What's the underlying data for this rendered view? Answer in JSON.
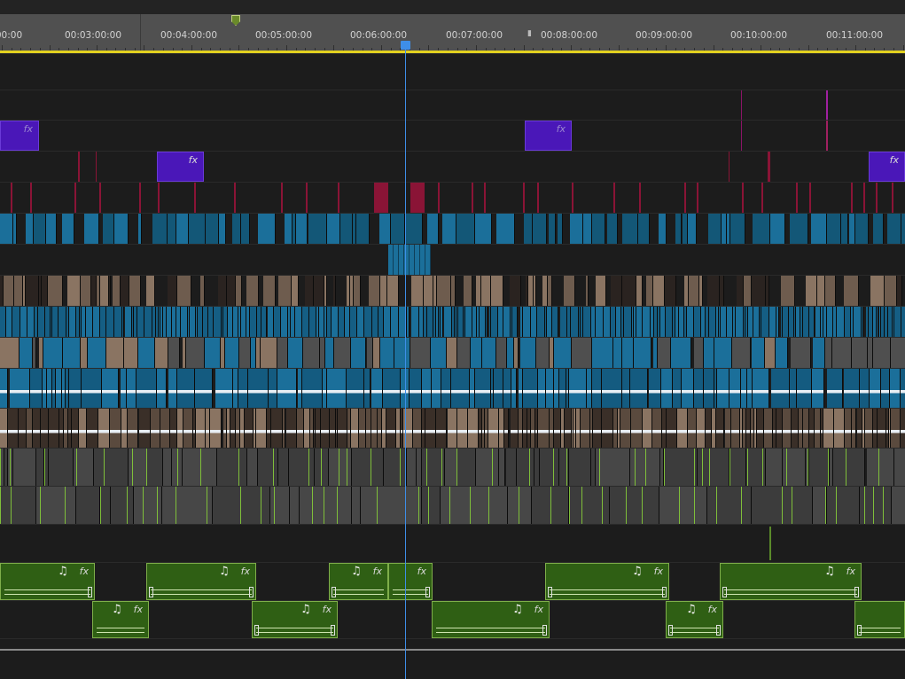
{
  "ruler": {
    "timecodes": [
      "00:00",
      "00:03:00:00",
      "00:04:00:00",
      "00:05:00:00",
      "00:06:00:00",
      "00:07:00:00",
      "00:08:00:00",
      "00:09:00:00",
      "00:10:00:00",
      "00:11:00:00"
    ]
  },
  "clips": {
    "fx_label": "fx",
    "music_glyph": "♫"
  },
  "colors": {
    "title_clip": "#4a17b8",
    "adjustment": "#8a1436",
    "video_blue": "#1b6f9a",
    "video_tan": "#8a7462",
    "audio_green": "#2f5f14",
    "audio_grey": "#474747",
    "playhead": "#3e8ee8",
    "work_area": "#e2d11f"
  },
  "icons": {
    "marker": "marker-icon",
    "playhead": "playhead-icon",
    "music": "music-note-icon",
    "fx": "fx-badge-icon"
  }
}
